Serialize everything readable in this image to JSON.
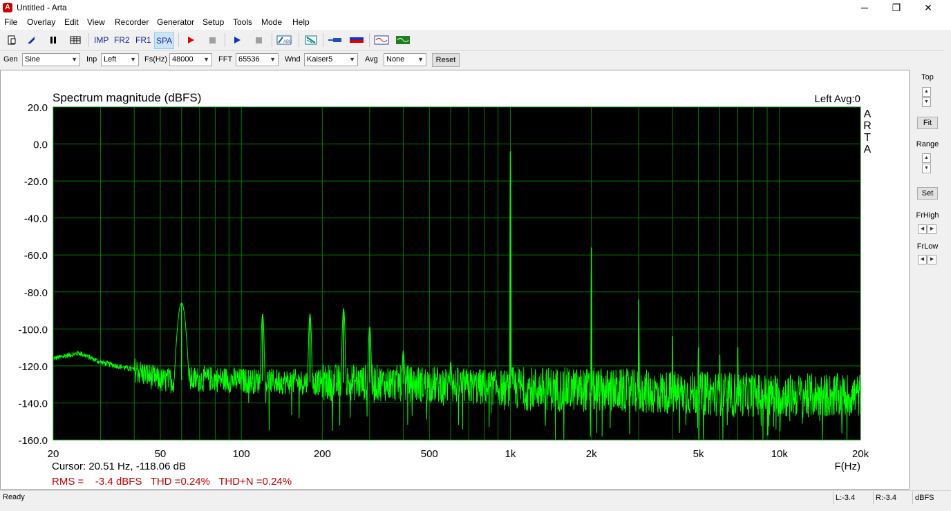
{
  "window": {
    "title": "Untitled - Arta",
    "minimize": "─",
    "maximize": "❐",
    "close": "✕"
  },
  "menu": [
    "File",
    "Overlay",
    "Edit",
    "View",
    "Recorder",
    "Generator",
    "Setup",
    "Tools",
    "Mode",
    "Help"
  ],
  "toolbar": {
    "imp": "IMP",
    "fr2": "FR2",
    "fr1": "FR1",
    "spa": "SPA"
  },
  "options": {
    "gen_label": "Gen",
    "gen_value": "Sine",
    "inp_label": "Inp",
    "inp_value": "Left",
    "fs_label": "Fs(Hz)",
    "fs_value": "48000",
    "fft_label": "FFT",
    "fft_value": "65536",
    "wnd_label": "Wnd",
    "wnd_value": "Kaiser5",
    "avg_label": "Avg",
    "avg_value": "None",
    "reset_label": "Reset"
  },
  "right_panel": {
    "top": "Top",
    "fit": "Fit",
    "range": "Range",
    "set": "Set",
    "frhigh": "FrHigh",
    "frlow": "FrLow"
  },
  "plot": {
    "cursor": "Cursor: 20.51 Hz, -118.06 dB",
    "rms": "RMS =    -3.4 dBFS   THD =0.24%   THD+N =0.24%"
  },
  "status": {
    "ready": "Ready",
    "l": "L:-3.4",
    "r": "R:-3.4",
    "unit": "dBFS"
  },
  "colors": {
    "trace": "#00ff00",
    "grid": "#008000",
    "background": "#000000",
    "rms_text": "#c00000"
  },
  "chart_data": {
    "type": "line",
    "title": "Spectrum magnitude (dBFS)",
    "channel_label": "Left  Avg:0",
    "brand": "ARTA",
    "xlabel": "F(Hz)",
    "xscale": "log",
    "xlim": [
      20,
      20000
    ],
    "ylim": [
      -160,
      20
    ],
    "xticks": [
      20,
      50,
      100,
      200,
      500,
      1000,
      2000,
      5000,
      10000,
      20000
    ],
    "xtick_labels": [
      "20",
      "50",
      "100",
      "200",
      "500",
      "1k",
      "2k",
      "5k",
      "10k",
      "20k"
    ],
    "yticks": [
      20,
      0,
      -20,
      -40,
      -60,
      -80,
      -100,
      -120,
      -140,
      -160
    ],
    "ytick_labels": [
      "20.0",
      "0.0",
      "-20.0",
      "-40.0",
      "-60.0",
      "-80.0",
      "-100.0",
      "-120.0",
      "-140.0",
      "-160.0"
    ],
    "grid": true,
    "series": [
      {
        "noise_floor": [
          [
            20,
            -116
          ],
          [
            25,
            -113
          ],
          [
            30,
            -118
          ],
          [
            40,
            -122
          ],
          [
            50,
            -128
          ],
          [
            80,
            -127
          ],
          [
            100,
            -128
          ],
          [
            200,
            -129
          ],
          [
            300,
            -129
          ],
          [
            500,
            -130
          ],
          [
            700,
            -131
          ],
          [
            1000,
            -132
          ],
          [
            2000,
            -133
          ],
          [
            5000,
            -135
          ],
          [
            10000,
            -136
          ],
          [
            20000,
            -136
          ]
        ],
        "peaks": [
          [
            60,
            -86
          ],
          [
            120,
            -92
          ],
          [
            180,
            -92
          ],
          [
            240,
            -89
          ],
          [
            300,
            -99
          ],
          [
            400,
            -112
          ],
          [
            600,
            -118
          ],
          [
            1000,
            -4
          ],
          [
            2000,
            -56
          ],
          [
            3000,
            -84
          ],
          [
            4000,
            -104
          ],
          [
            5000,
            -110
          ],
          [
            6000,
            -114
          ],
          [
            7000,
            -110
          ]
        ]
      }
    ]
  }
}
